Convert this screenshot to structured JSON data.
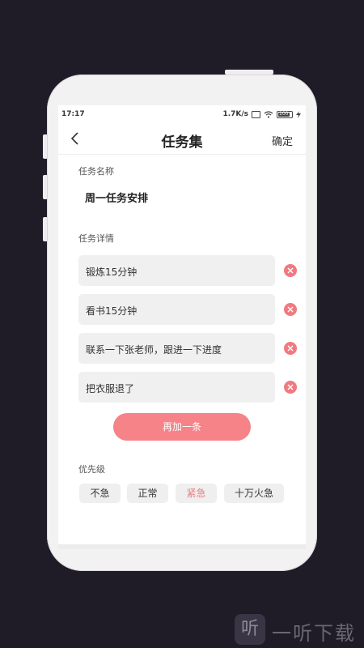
{
  "status_bar": {
    "time": "17:17",
    "network_speed": "1.7K/s",
    "battery_level": "100"
  },
  "header": {
    "title": "任务集",
    "confirm_label": "确定",
    "back_icon": "chevron-left-icon"
  },
  "form": {
    "task_name_label": "任务名称",
    "task_name_value": "周一任务安排",
    "details_label": "任务详情",
    "details": [
      {
        "text": "锻炼15分钟"
      },
      {
        "text": "看书15分钟"
      },
      {
        "text": "联系一下张老师，跟进一下进度"
      },
      {
        "text": "把衣服退了"
      }
    ],
    "add_button_label": "再加一条",
    "priority_label": "优先级",
    "priority_options": [
      {
        "label": "不急",
        "selected": false
      },
      {
        "label": "正常",
        "selected": false
      },
      {
        "label": "紧急",
        "selected": true
      },
      {
        "label": "十万火急",
        "selected": false
      }
    ]
  },
  "watermark": {
    "logo_glyph": "听",
    "text": "一听下载"
  },
  "colors": {
    "accent": "#f58388",
    "delete": "#f07a80",
    "background": "#1f1b27"
  }
}
